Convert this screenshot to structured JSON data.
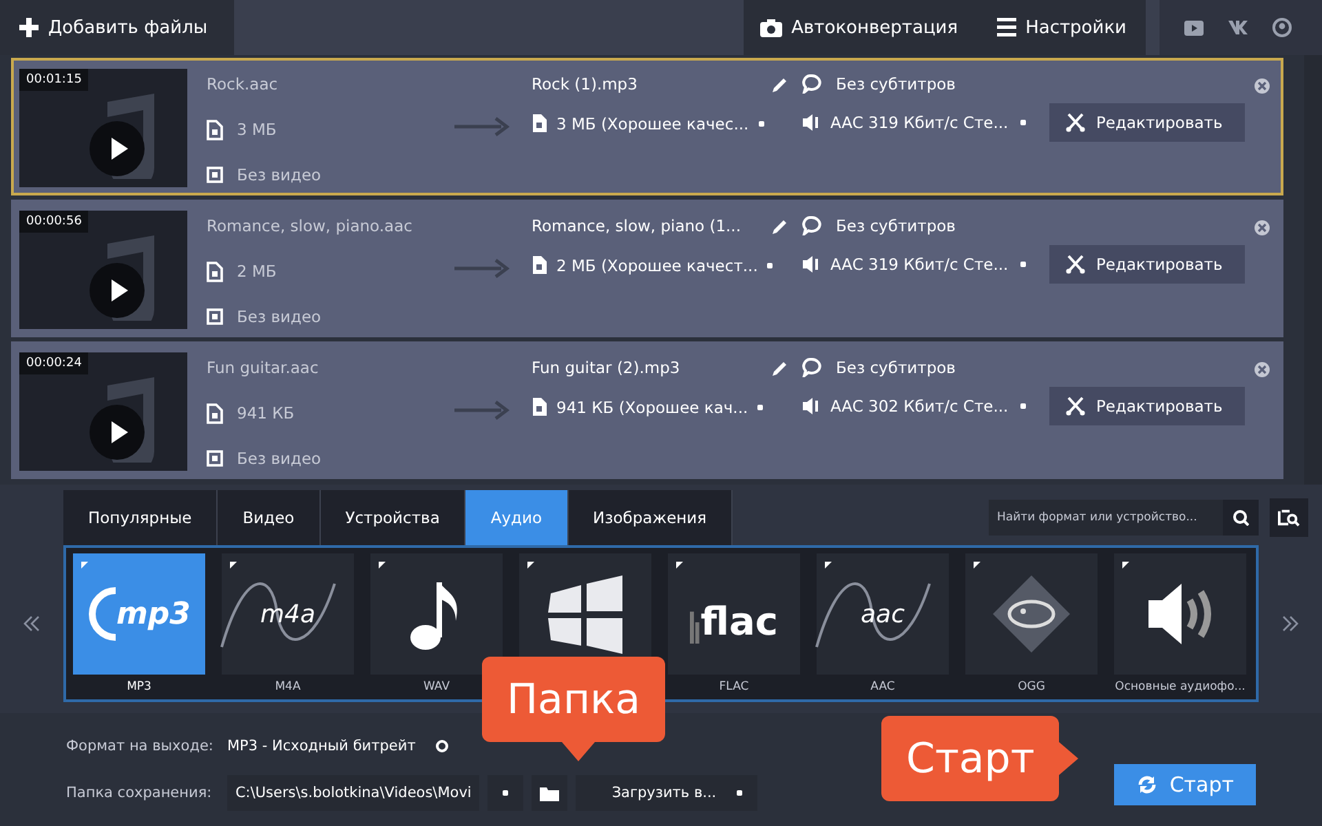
{
  "toolbar": {
    "add_files": "Добавить файлы",
    "autoconvert": "Автоконвертация",
    "settings": "Настройки"
  },
  "files": [
    {
      "selected": true,
      "duration": "00:01:15",
      "source_name": "Rock.aac",
      "source_size": "3 МБ",
      "video": "Без видео",
      "output_name": "Rock (1).mp3",
      "output_size": "3 МБ (Хорошее качес...",
      "subtitles": "Без субтитров",
      "audio": "AAC 319 Кбит/с Сте...",
      "edit": "Редактировать"
    },
    {
      "selected": false,
      "duration": "00:00:56",
      "source_name": "Romance, slow, piano.aac",
      "source_size": "2 МБ",
      "video": "Без видео",
      "output_name": "Romance, slow, piano (1...",
      "output_size": "2 МБ (Хорошее качест...",
      "subtitles": "Без субтитров",
      "audio": "AAC 319 Кбит/с Сте...",
      "edit": "Редактировать"
    },
    {
      "selected": false,
      "duration": "00:00:24",
      "source_name": "Fun guitar.aac",
      "source_size": "941 КБ",
      "video": "Без видео",
      "output_name": "Fun guitar (2).mp3",
      "output_size": "941 КБ (Хорошее кач...",
      "subtitles": "Без субтитров",
      "audio": "AAC 302 Кбит/с Сте...",
      "edit": "Редактировать"
    }
  ],
  "format_tabs": [
    {
      "label": "Популярные",
      "selected": false
    },
    {
      "label": "Видео",
      "selected": false
    },
    {
      "label": "Устройства",
      "selected": false
    },
    {
      "label": "Аудио",
      "selected": true
    },
    {
      "label": "Изображения",
      "selected": false
    }
  ],
  "format_search": {
    "placeholder": "Найти формат или устройство..."
  },
  "formats": [
    {
      "kind": "mp3",
      "logo": "mp3",
      "label": "MP3",
      "selected": true
    },
    {
      "kind": "m4a",
      "logo": "m4a",
      "label": "M4A",
      "selected": false
    },
    {
      "kind": "wav",
      "label": "WAV",
      "selected": false
    },
    {
      "kind": "wma",
      "selected": false
    },
    {
      "kind": "flac",
      "logo": "flac",
      "label": "FLAC",
      "selected": false
    },
    {
      "kind": "aac",
      "logo": "aac",
      "label": "AAC",
      "selected": false
    },
    {
      "kind": "ogg",
      "label": "OGG",
      "selected": false
    },
    {
      "kind": "speaker",
      "label": "Основные аудиофо...",
      "selected": false
    }
  ],
  "output": {
    "format_label": "Формат на выходе:",
    "format_value": "MP3 - Исходный битрейт",
    "folder_label": "Папка сохранения:",
    "folder_value": "C:\\Users\\s.bolotkina\\Videos\\Movi",
    "upload": "Загрузить в...",
    "start": "Старт"
  },
  "callouts": [
    {
      "kind": "down",
      "text": "Папка"
    },
    {
      "kind": "right",
      "text": "Старт"
    }
  ]
}
